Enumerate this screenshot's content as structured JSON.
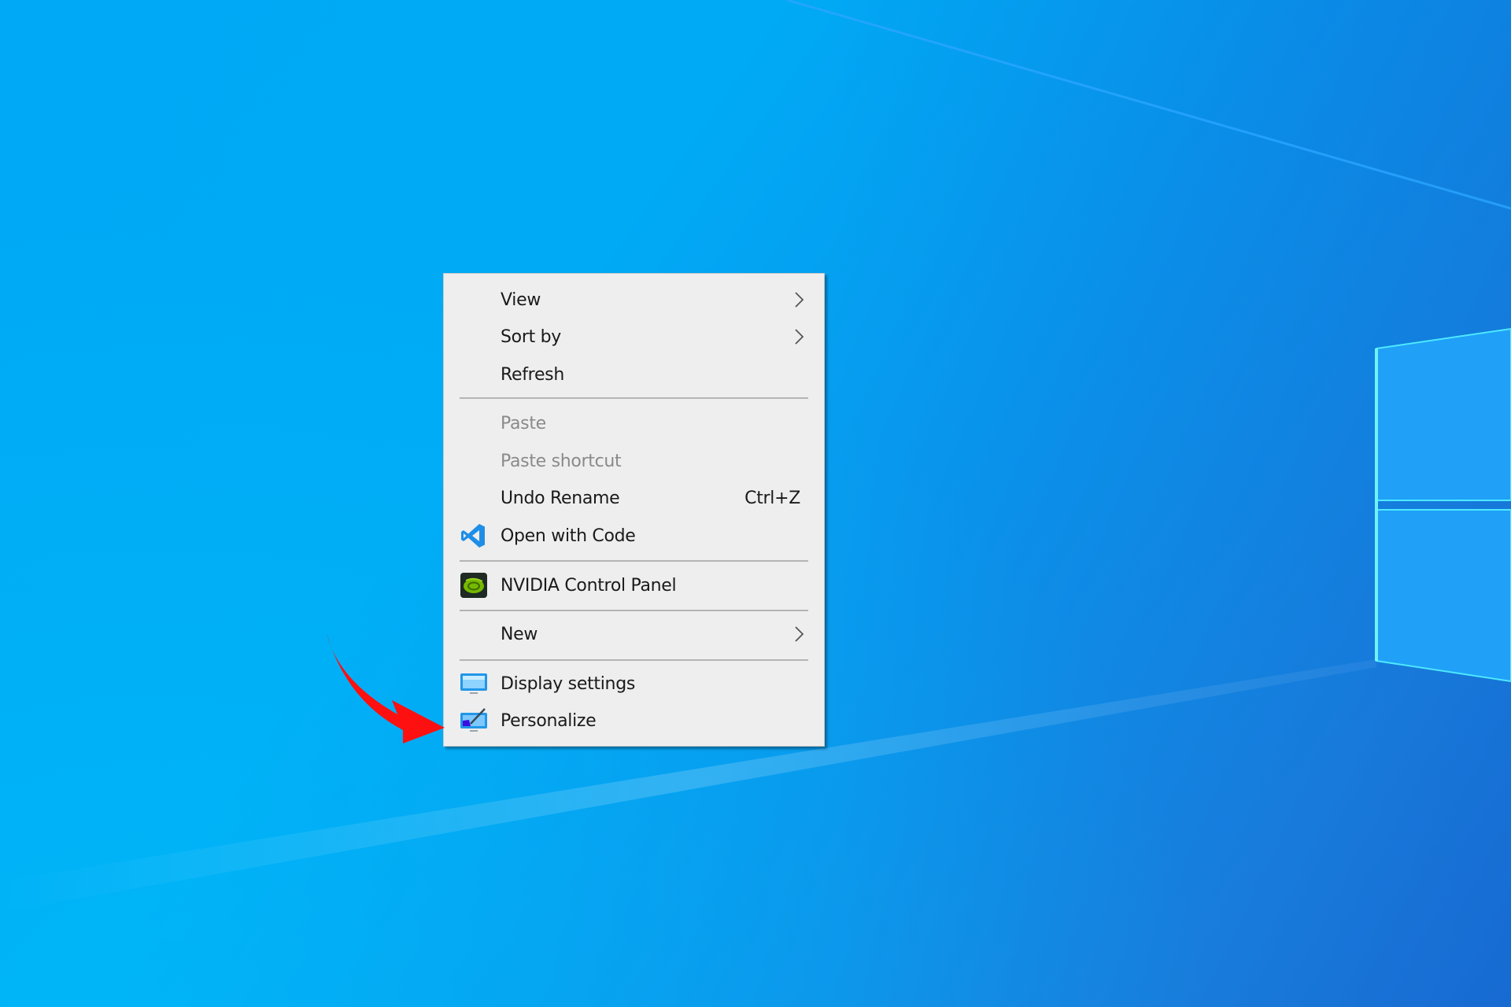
{
  "desktop": {
    "wallpaper": "windows-10-hero-blue",
    "colors": {
      "background_top_left": "#00a8f4",
      "background_top_right": "#1a8ae6",
      "background_bottom_left": "#00b4f6",
      "background_bottom_right": "#1a88e0",
      "logo_pane": "#22a2f8",
      "logo_edge": "#4de8ff"
    }
  },
  "context_menu": {
    "colors": {
      "background": "#eeeeee",
      "text": "#1a1a1a",
      "disabled_text": "#8a8a8a",
      "separator": "#b4b4b4"
    },
    "items": [
      {
        "label": "View",
        "submenu": true,
        "enabled": true,
        "icon": null
      },
      {
        "label": "Sort by",
        "submenu": true,
        "enabled": true,
        "icon": null
      },
      {
        "label": "Refresh",
        "enabled": true,
        "icon": null
      },
      {
        "label": "Paste",
        "enabled": false,
        "icon": null
      },
      {
        "label": "Paste shortcut",
        "enabled": false,
        "icon": null
      },
      {
        "label": "Undo Rename",
        "shortcut": "Ctrl+Z",
        "enabled": true,
        "icon": null
      },
      {
        "label": "Open with Code",
        "enabled": true,
        "icon": "vscode-icon"
      },
      {
        "label": "NVIDIA Control Panel",
        "enabled": true,
        "icon": "nvidia-icon"
      },
      {
        "label": "New",
        "submenu": true,
        "enabled": true,
        "icon": null
      },
      {
        "label": "Display settings",
        "enabled": true,
        "icon": "display-settings-icon"
      },
      {
        "label": "Personalize",
        "enabled": true,
        "icon": "personalize-icon"
      }
    ]
  },
  "annotation": {
    "type": "red-arrow",
    "color": "#ff0000",
    "points_to": "Personalize"
  }
}
